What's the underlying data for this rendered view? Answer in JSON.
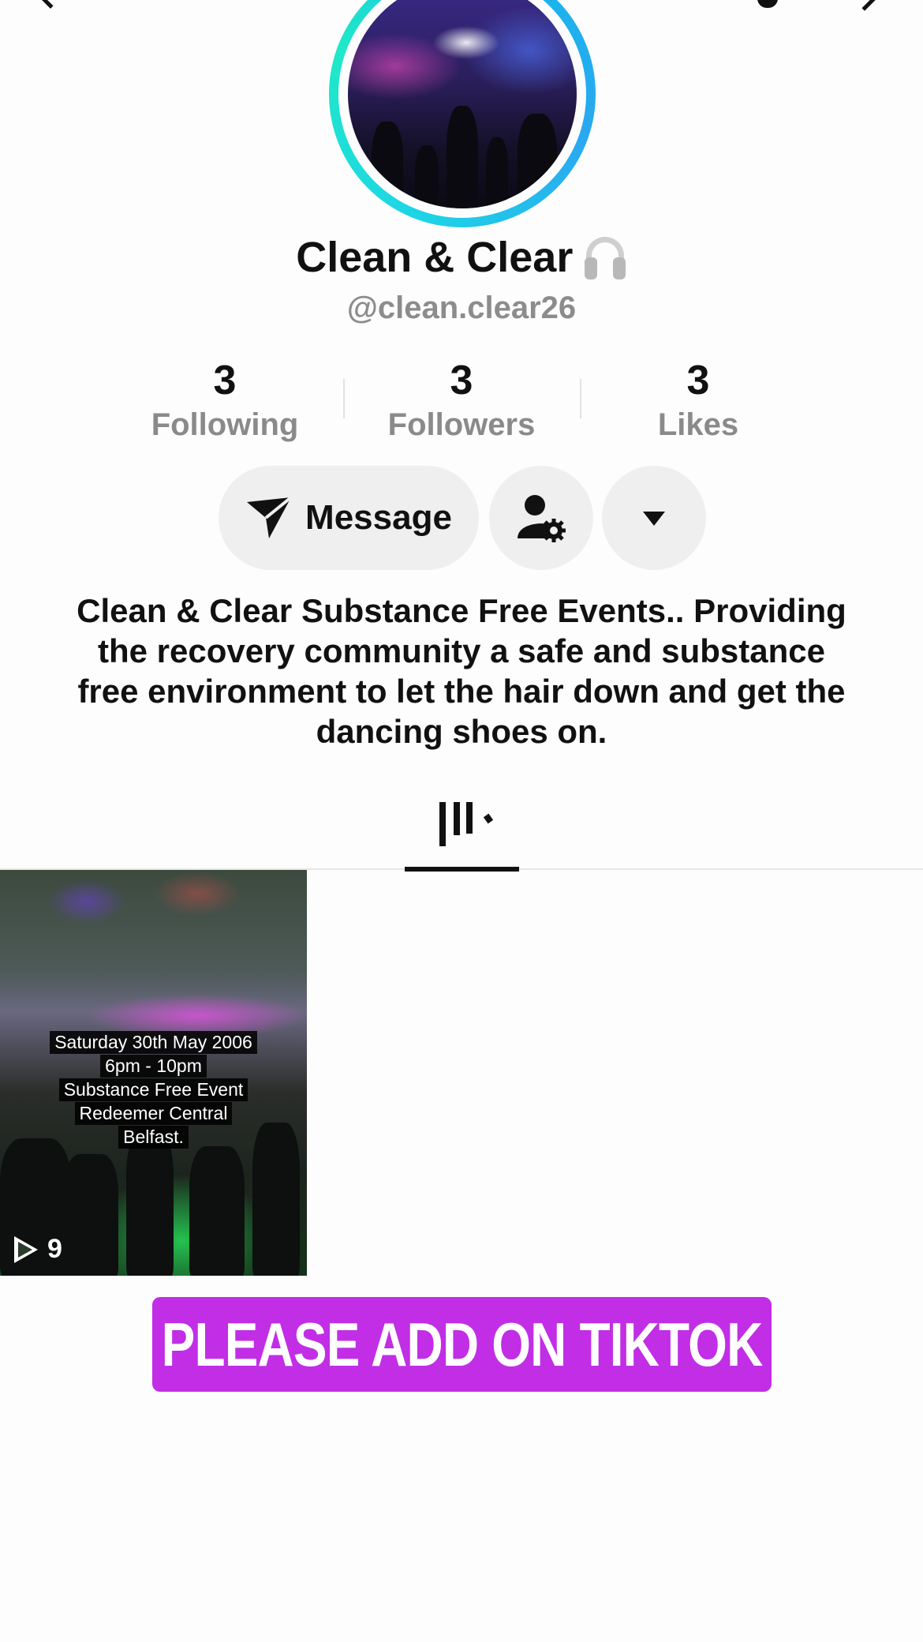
{
  "profile": {
    "display_name": "Clean & Clear",
    "name_emoji_icon": "headphones-icon",
    "handle": "@clean.clear26"
  },
  "stats": [
    {
      "value": "3",
      "label": "Following"
    },
    {
      "value": "3",
      "label": "Followers"
    },
    {
      "value": "3",
      "label": "Likes"
    }
  ],
  "actions": {
    "message_label": "Message",
    "message_icon": "send-icon",
    "manage_icon": "user-gear-icon",
    "more_icon": "chevron-down-icon"
  },
  "bio": "Clean & Clear Substance Free Events.. Providing the recovery community a safe and substance free environment to let the hair down and get the dancing shoes on.",
  "tabs": [
    {
      "icon": "grid-icon",
      "active": true
    }
  ],
  "videos": [
    {
      "caption_lines": [
        "Saturday 30th May 2006",
        "6pm - 10pm",
        "Substance Free Event",
        "Redeemer Central",
        "Belfast."
      ],
      "play_count": "9"
    }
  ],
  "banner": {
    "text": "PLEASE ADD ON TIKTOK",
    "color": "#c12ee6"
  },
  "colors": {
    "avatar_ring": "#1dd5e6",
    "secondary_text": "#8a8a8a",
    "button_bg": "#efefef"
  }
}
